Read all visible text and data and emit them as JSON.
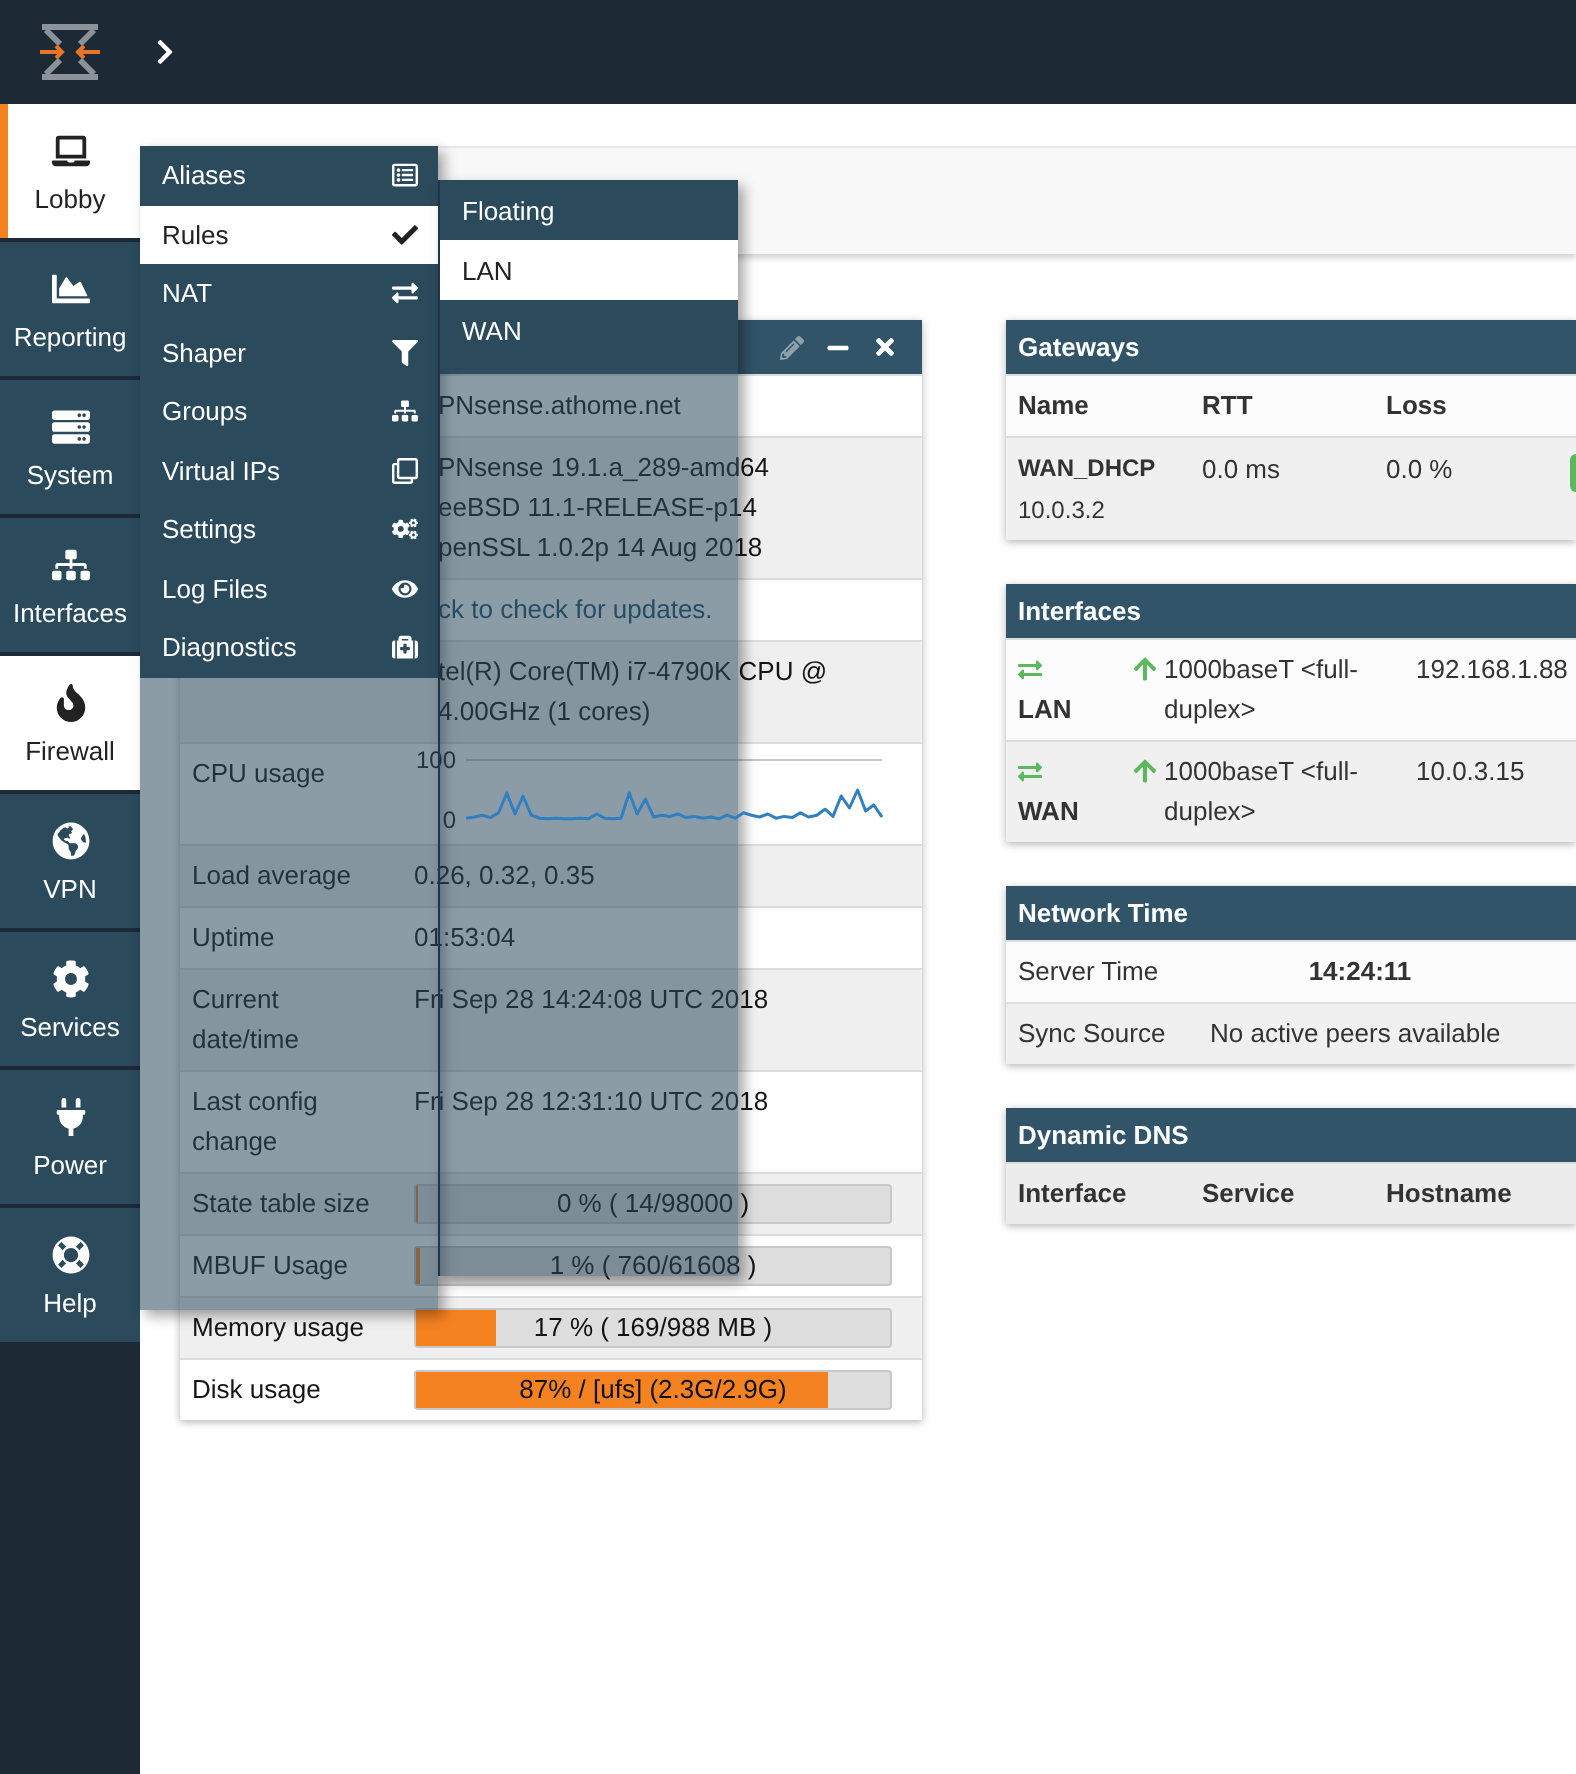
{
  "sidebar": {
    "items": [
      {
        "label": "Lobby",
        "selected": true,
        "expanded": false
      },
      {
        "label": "Reporting",
        "selected": false,
        "expanded": false
      },
      {
        "label": "System",
        "selected": false,
        "expanded": false
      },
      {
        "label": "Interfaces",
        "selected": false,
        "expanded": false
      },
      {
        "label": "Firewall",
        "selected": false,
        "expanded": true
      },
      {
        "label": "VPN",
        "selected": false,
        "expanded": false
      },
      {
        "label": "Services",
        "selected": false,
        "expanded": false
      },
      {
        "label": "Power",
        "selected": false,
        "expanded": false
      },
      {
        "label": "Help",
        "selected": false,
        "expanded": false
      }
    ]
  },
  "firewall_menu": {
    "items": [
      {
        "label": "Aliases",
        "selected": false
      },
      {
        "label": "Rules",
        "selected": true,
        "submenu": [
          {
            "label": "Floating",
            "selected": false
          },
          {
            "label": "LAN",
            "selected": true
          },
          {
            "label": "WAN",
            "selected": false
          }
        ]
      },
      {
        "label": "NAT",
        "selected": false
      },
      {
        "label": "Shaper",
        "selected": false
      },
      {
        "label": "Groups",
        "selected": false
      },
      {
        "label": "Virtual IPs",
        "selected": false
      },
      {
        "label": "Settings",
        "selected": false
      },
      {
        "label": "Log Files",
        "selected": false
      },
      {
        "label": "Diagnostics",
        "selected": false
      }
    ]
  },
  "system_widget": {
    "rows": [
      {
        "kind": "text",
        "value": "PNsense.athome.net"
      },
      {
        "kind": "lines",
        "lines": [
          "PNsense 19.1.a_289-amd64",
          "eeBSD 11.1-RELEASE-p14",
          "penSSL 1.0.2p 14 Aug 2018"
        ]
      },
      {
        "kind": "link",
        "value": "ck to check for updates."
      },
      {
        "kind": "lines",
        "lines": [
          "tel(R) Core(TM) i7-4790K CPU @",
          "4.00GHz (1 cores)"
        ]
      },
      {
        "kind": "chart",
        "label": "CPU usage",
        "chart_data": {
          "type": "line",
          "ylim": [
            0,
            100
          ],
          "yticks": [
            0,
            100
          ],
          "series": [
            {
              "color": "#2f7fc1",
              "values": [
                3,
                5,
                8,
                4,
                12,
                45,
                10,
                40,
                8,
                3,
                2,
                3,
                2,
                2,
                3,
                2,
                10,
                3,
                2,
                3,
                45,
                10,
                35,
                5,
                8,
                6,
                10,
                4,
                6,
                3,
                5,
                2,
                8,
                3,
                12,
                8,
                5,
                10,
                3,
                6,
                4,
                12,
                5,
                8,
                18,
                6,
                40,
                20,
                50,
                15,
                25,
                5
              ]
            }
          ]
        }
      },
      {
        "kind": "text",
        "label": "Load average",
        "value": "0.26, 0.32, 0.35"
      },
      {
        "kind": "text",
        "label": "Uptime",
        "value": "01:53:04"
      },
      {
        "kind": "text",
        "label": "Current date/time",
        "value": "Fri Sep 28 14:24:08 UTC 2018"
      },
      {
        "kind": "text",
        "label": "Last config change",
        "value": "Fri Sep 28 12:31:10 UTC 2018"
      },
      {
        "kind": "bar",
        "label": "State table size",
        "level": 0,
        "reading": "0 % ( 14/98000 )"
      },
      {
        "kind": "bar",
        "label": "MBUF Usage",
        "level": 0.01,
        "reading": "1 % ( 760/61608 )"
      },
      {
        "kind": "bar",
        "label": "Memory usage",
        "level": 0.17,
        "reading": "17 % ( 169/988 MB )"
      },
      {
        "kind": "bar",
        "label": "Disk usage",
        "level": 0.87,
        "reading": "87% / [ufs] (2.3G/2.9G)"
      }
    ]
  },
  "gateways_widget": {
    "title": "Gateways",
    "columns": [
      "Name",
      "RTT",
      "Loss"
    ],
    "rows": [
      {
        "name": "WAN_DHCP",
        "address": "10.0.3.2",
        "rtt": "0.0 ms",
        "loss": "0.0 %",
        "color": "#5cb85c"
      }
    ]
  },
  "interfaces_widget": {
    "title": "Interfaces",
    "rows": [
      {
        "name": "LAN",
        "up": true,
        "media": "1000baseT <full-duplex>",
        "address": "192.168.1.88"
      },
      {
        "name": "WAN",
        "up": true,
        "media": "1000baseT <full-duplex>",
        "address": "10.0.3.15"
      }
    ]
  },
  "network_time_widget": {
    "title": "Network Time",
    "rows": [
      {
        "kind": "time",
        "label": "Server Time",
        "value": "14:24:11"
      },
      {
        "kind": "text",
        "label": "Sync Source",
        "value": "No active peers available"
      }
    ]
  },
  "ddns_widget": {
    "title": "Dynamic DNS",
    "columns": [
      "Interface",
      "Service",
      "Hostname"
    ]
  }
}
